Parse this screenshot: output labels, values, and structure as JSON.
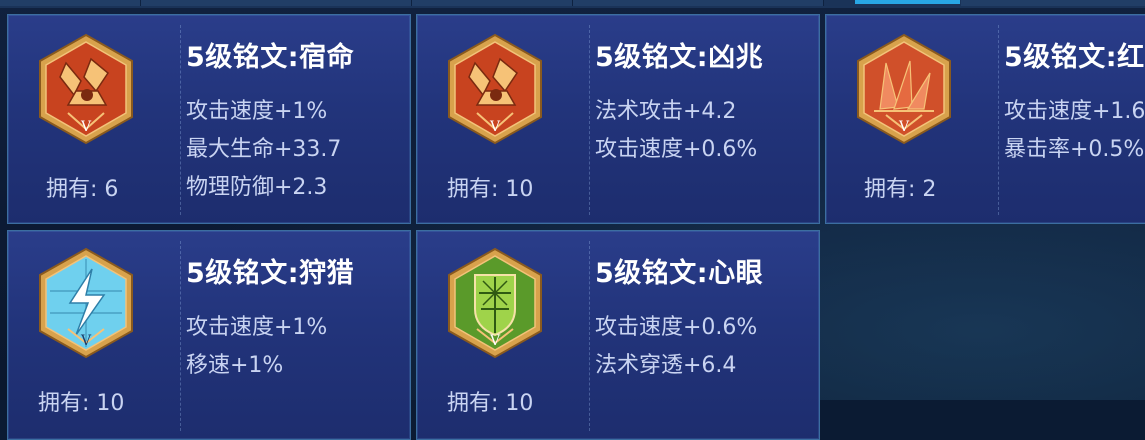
{
  "cards": [
    {
      "title": "5级铭文:宿命",
      "stats": [
        "攻击速度+1%",
        "最大生命+33.7",
        "物理防御+2.3"
      ],
      "owned": "拥有: 6",
      "icon": "red-petal-rune-icon",
      "grade": "V"
    },
    {
      "title": "5级铭文:凶兆",
      "stats": [
        "法术攻击+4.2",
        "攻击速度+0.6%"
      ],
      "owned": "拥有: 10",
      "icon": "red-petal-rune-icon",
      "grade": "V"
    },
    {
      "title": "5级铭文:红",
      "stats": [
        "攻击速度+1.6",
        "暴击率+0.5%"
      ],
      "owned": "拥有: 2",
      "icon": "red-fan-rune-icon",
      "grade": "V"
    },
    {
      "title": "5级铭文:狩猎",
      "stats": [
        "攻击速度+1%",
        "移速+1%"
      ],
      "owned": "拥有: 10",
      "icon": "blue-lightning-rune-icon",
      "grade": "V"
    },
    {
      "title": "5级铭文:心眼",
      "stats": [
        "攻击速度+0.6%",
        "法术穿透+6.4"
      ],
      "owned": "拥有: 10",
      "icon": "green-shield-rune-icon",
      "grade": "V"
    }
  ],
  "colors": {
    "red": "#c8431f",
    "blue": "#5ec4e8",
    "green": "#5a9a2a",
    "gold": "#e2b35a"
  }
}
